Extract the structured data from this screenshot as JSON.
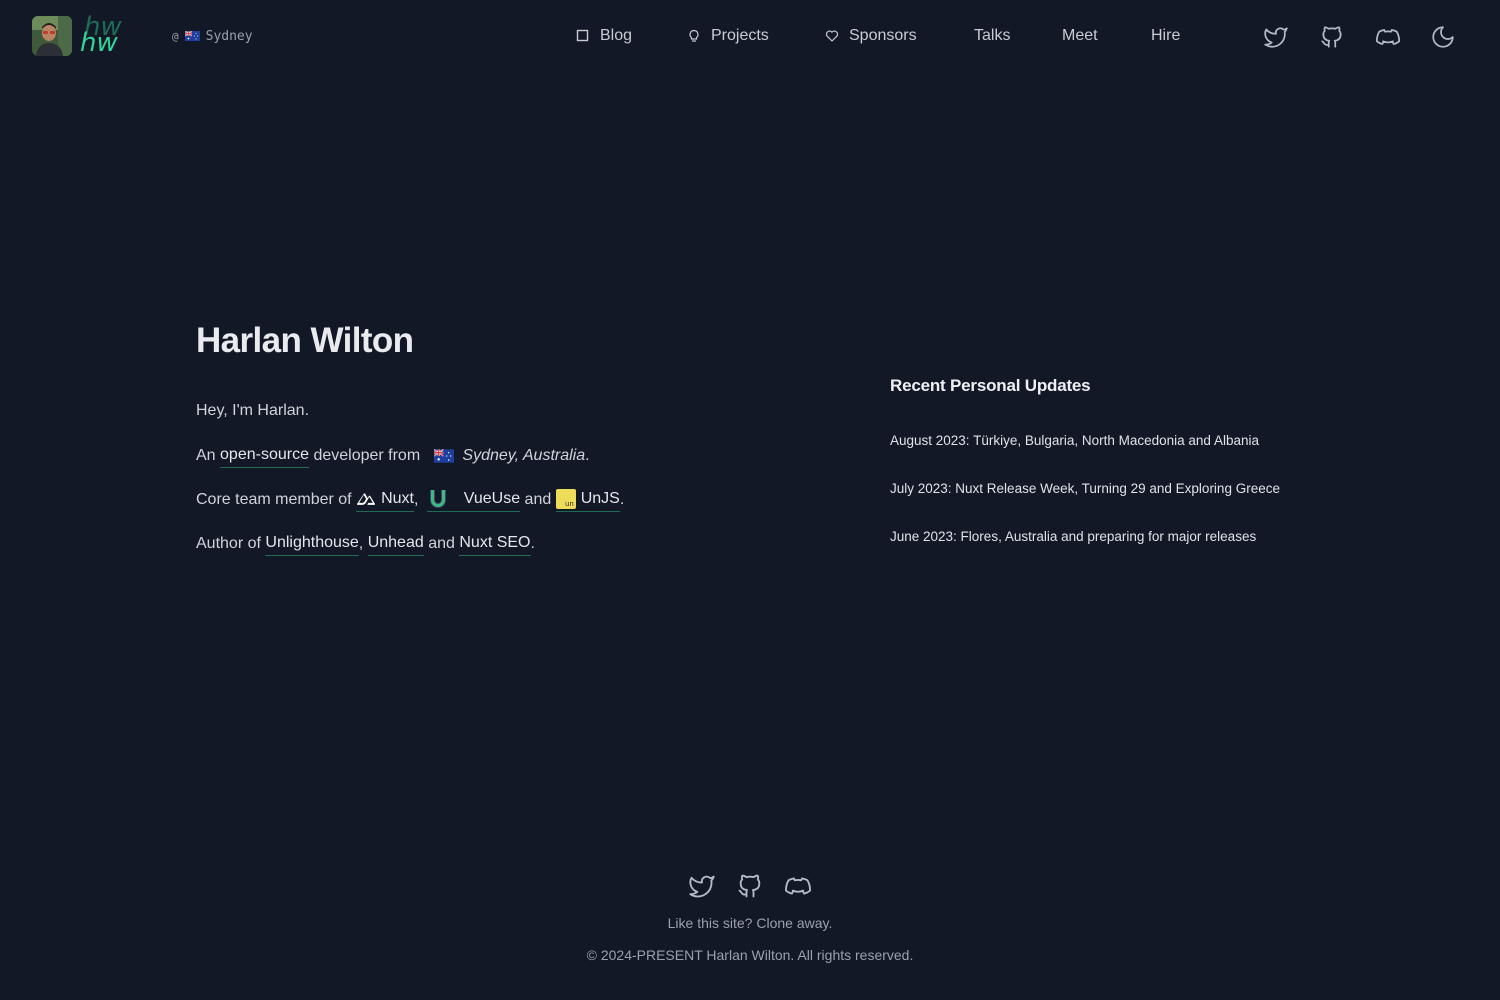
{
  "header": {
    "logo_text": "hw",
    "location": {
      "at": "@",
      "flag": "australia-flag",
      "city": "Sydney"
    },
    "nav": [
      {
        "label": "Blog",
        "icon": "square-icon"
      },
      {
        "label": "Projects",
        "icon": "lightbulb-icon"
      },
      {
        "label": "Sponsors",
        "icon": "heart-icon"
      },
      {
        "label": "Talks",
        "icon": ""
      },
      {
        "label": "Meet",
        "icon": ""
      },
      {
        "label": "Hire",
        "icon": ""
      }
    ],
    "social": [
      "twitter-icon",
      "github-icon",
      "discord-icon"
    ],
    "theme_toggle_icon": "moon-icon"
  },
  "intro": {
    "name": "Harlan Wilton",
    "greeting": "Hey, I'm Harlan.",
    "line2": {
      "prefix": "An",
      "link": "open-source",
      "middle": "developer from",
      "place": "Sydney, Australia",
      "suffix": "."
    },
    "line3": {
      "prefix": "Core team member of",
      "nuxt": "Nuxt",
      "comma": ",",
      "vueuse": "VueUse",
      "and": "and",
      "unjs": "UnJS",
      "suffix": "."
    },
    "line4": {
      "prefix": "Author of",
      "unlighthouse": "Unlighthouse",
      "comma": ",",
      "unhead": "Unhead",
      "and": "and",
      "nuxtseo": "Nuxt SEO",
      "suffix": "."
    }
  },
  "updates": {
    "title": "Recent Personal Updates",
    "items": [
      "August 2023: Türkiye, Bulgaria, North Macedonia and Albania",
      "July 2023: Nuxt Release Week, Turning 29 and Exploring Greece",
      "June 2023: Flores, Australia and preparing for major releases"
    ]
  },
  "footer": {
    "social": [
      "twitter-icon",
      "github-icon",
      "discord-icon"
    ],
    "clone_text": "Like this site? Clone away.",
    "copyright": "© 2024-PRESENT Harlan Wilton. All rights reserved."
  },
  "colors": {
    "background": "#121826",
    "accent": "#34d399",
    "link_underline": "#1f6b56",
    "muted_text": "#9aa1ad"
  }
}
